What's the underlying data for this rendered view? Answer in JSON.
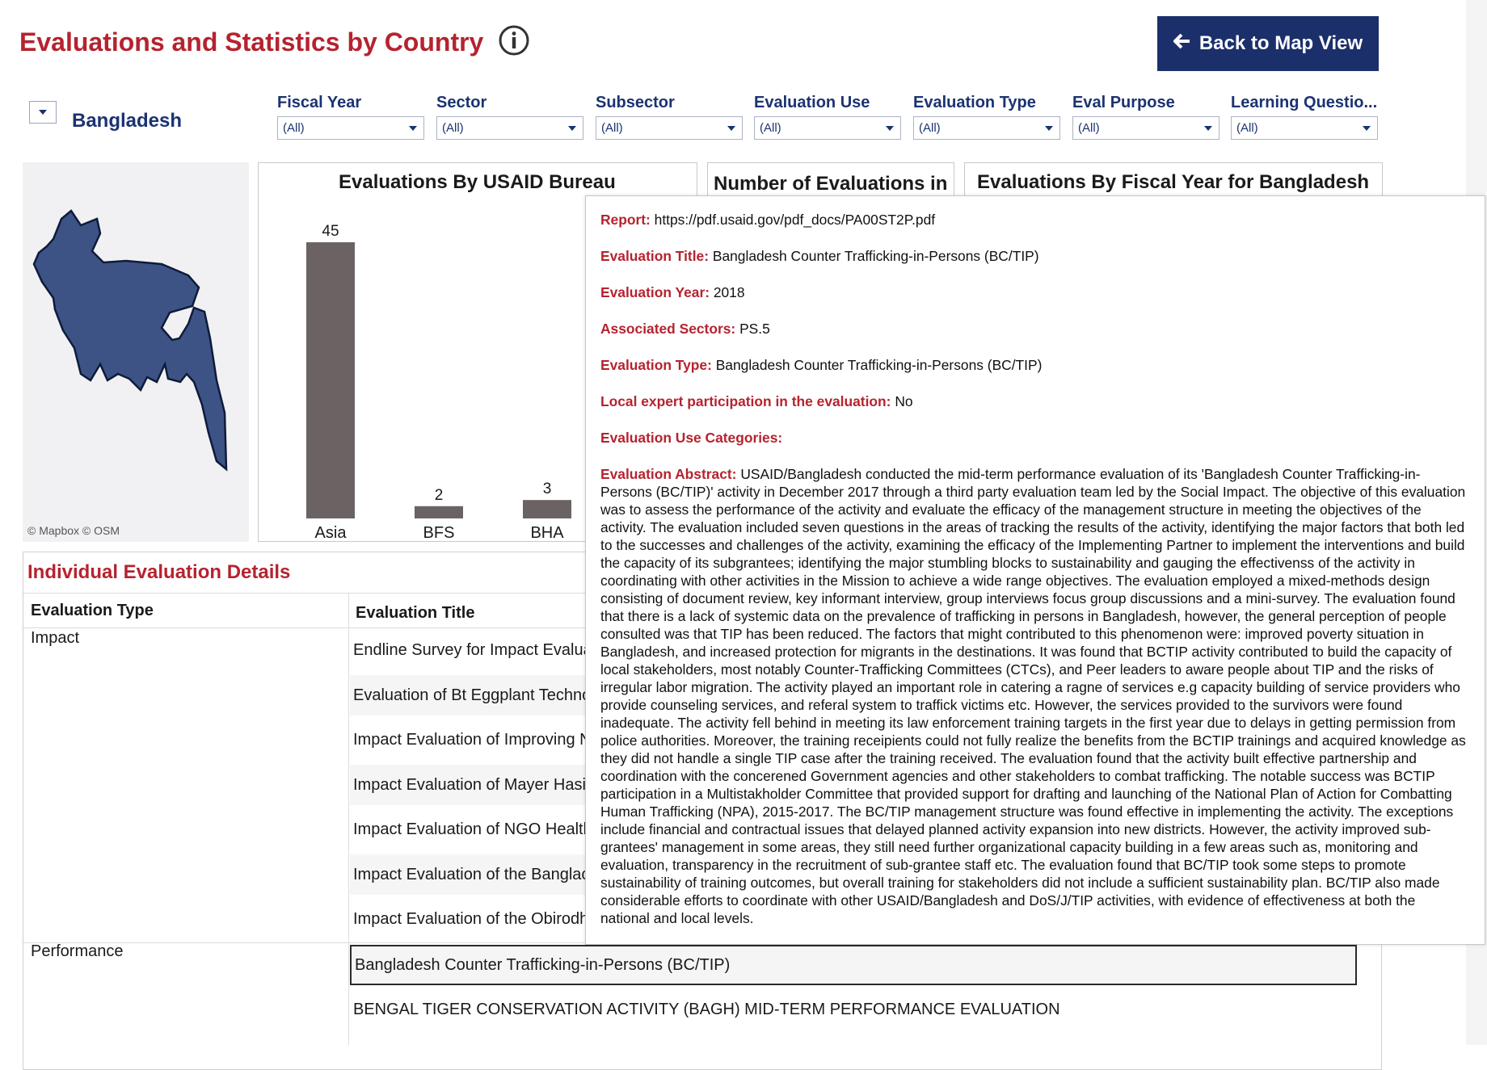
{
  "header": {
    "title": "Evaluations and Statistics by Country",
    "back_button": "Back to Map View"
  },
  "country": {
    "name": "Bangladesh"
  },
  "filters": [
    {
      "label": "Fiscal Year",
      "value": "(All)"
    },
    {
      "label": "Sector",
      "value": "(All)"
    },
    {
      "label": "Subsector",
      "value": "(All)"
    },
    {
      "label": "Evaluation Use",
      "value": "(All)"
    },
    {
      "label": "Evaluation Type",
      "value": "(All)"
    },
    {
      "label": "Eval Purpose",
      "value": "(All)"
    },
    {
      "label": "Learning Questio...",
      "value": "(All)"
    }
  ],
  "map": {
    "attribution": "© Mapbox  © OSM",
    "fill_color": "#3d5385"
  },
  "panels": {
    "bureau_title": "Evaluations By USAID Bureau",
    "number_title": "Number of Evaluations in",
    "fiscal_title": "Evaluations By Fiscal Year for Bangladesh"
  },
  "chart_data": {
    "type": "bar",
    "title": "Evaluations By USAID Bureau",
    "categories": [
      "Asia",
      "BFS",
      "BHA"
    ],
    "values": [
      45,
      2,
      3
    ],
    "ylim": [
      0,
      45
    ],
    "bar_color": "#6b6363"
  },
  "details": {
    "title": "Individual Evaluation Details",
    "col_type": "Evaluation Type",
    "col_title": "Evaluation Title",
    "groups": [
      {
        "type": "Impact",
        "rows": [
          "Endline Survey for Impact Evalua",
          "Evaluation of Bt Eggplant Techno",
          "Impact Evaluation of Improving N",
          "Impact Evaluation of Mayer Hasi",
          "Impact Evaluation of NGO Healtl",
          "Impact Evaluation of the Banglac",
          "Impact Evaluation of the Obirodh"
        ]
      },
      {
        "type": "Performance",
        "rows": [
          "Bangladesh Counter Trafficking-in-Persons (BC/TIP)",
          "BENGAL TIGER CONSERVATION ACTIVITY (BAGH) MID-TERM PERFORMANCE EVALUATION"
        ]
      }
    ]
  },
  "tooltip": {
    "fields": [
      {
        "key": "Report:",
        "value": "https://pdf.usaid.gov/pdf_docs/PA00ST2P.pdf"
      },
      {
        "key": "Evaluation Title:",
        "value": "Bangladesh Counter Trafficking-in-Persons (BC/TIP)"
      },
      {
        "key": "Evaluation Year:",
        "value": "2018"
      },
      {
        "key": "Associated Sectors:",
        "value": "PS.5"
      },
      {
        "key": "Evaluation Type:",
        "value": "Bangladesh Counter Trafficking-in-Persons (BC/TIP)"
      },
      {
        "key": "Local expert participation in the evaluation:",
        "value": "No"
      },
      {
        "key": "Evaluation Use Categories:",
        "value": ""
      }
    ],
    "abstract_key": "Evaluation Abstract:",
    "abstract": "USAID/Bangladesh conducted the mid-term performance evaluation of its 'Bangladesh Counter Trafficking-in-Persons (BC/TIP)' activity in December 2017 through a third party evaluation team led by the Social Impact. The objective of this evaluation was to assess the performance of the activity and evaluate the efficacy of the management structure in meeting the objectives of the activity. The evaluation included seven questions in the areas of tracking the results of the activity, identifying the major factors that both led to the successes and challenges of the activity, examining the efficacy of the Implementing Partner to implement the interventions and build the capacity of its subgrantees; identifying the major stumbling blocks to sustainability and gauging the effectivenss of the activity in coordinating with other activities in the Mission to achieve a wide range objectives. The evaluation employed a mixed-methods design consisting of document review, key informant interview, group interviews focus group discussions and a mini-survey. The evaluation found that there is a lack of systemic data on the prevalence of trafficking in persons in Bangladesh, however, the general perception of people consulted was that TIP has been reduced. The factors that might contributed to this phenomenon were: improved poverty situation in Bangladesh, and increased protection for migrants in the destinations. It was found that BCTIP activity contributed to build the capacity of local stakeholders, most notably Counter-Trafficking Committees (CTCs), and Peer leaders to aware people about TIP and the risks of irregular labor migration. The activity played an important role in catering a ragne of services e.g capacity building of service providers who provide counseling services, and referal system to traffick victims etc. However, the services provided to the survivors were found inadequate. The activity fell behind in meeting its law enforcement training targets in the first year due to delays in getting permission from police authorities. Moreover, the training receipients could not fully realize the benefits from the BCTIP trainings and acquired knowledge as they did not handle a single TIP case after the training received. The evaluation found that the activity built effective partnership and coordination with the concerened Government agencies and other stakeholders to combat trafficking. The notable success was BCTIP participation in a Multistakholder Committee that provided support for drafting and launching of the National Plan of Action for Combatting Human Trafficking (NPA), 2015-2017. The BC/TIP management structure was found effective in implementing the activity. The exceptions include financial and contractual issues that delayed planned activity expansion into new districts. However, the activity improved sub-grantees' management in some areas, they still need further organizational capacity building in a few areas such as, monitoring and evaluation, transparency in the recruitment of sub-grantee staff etc. The evaluation found that BC/TIP took some steps to promote sustainability of training outcomes, but overall training for stakeholders did not include a sufficient sustainability plan. BC/TIP also made considerable efforts to coordinate with other USAID/Bangladesh and DoS/J/TIP activities, with evidence of effectiveness at both the national and local levels."
  }
}
